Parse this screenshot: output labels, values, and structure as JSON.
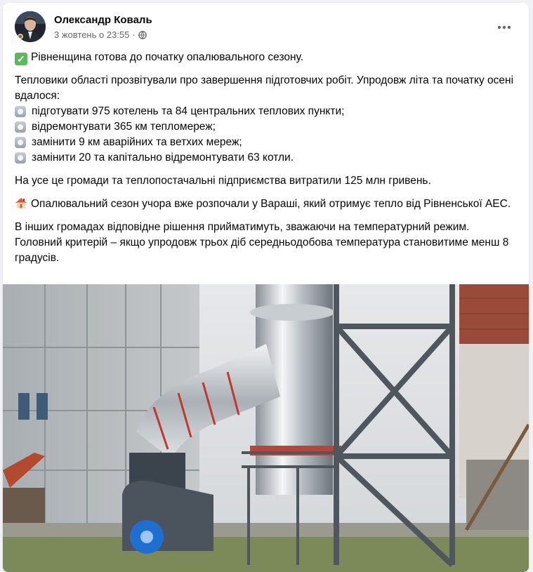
{
  "post": {
    "author": "Олександр Коваль",
    "timestamp": "3 жовтень о 23:55",
    "separator": "·",
    "more_label": "•••",
    "headline": "Рівненщина готова до початку опалювального сезону.",
    "intro": "Тепловики області прозвітували про завершення підготовчих робіт. Упродовж літа та початку осені вдалося:",
    "bullets": [
      "підготувати 975 котелень та 84 центральних теплових пункти;",
      "відремонтувати 365 км тепломереж;",
      "замінити 9 км аварійних та ветхих мереж;",
      "замінити 20 та капітально відремонтувати 63 котли."
    ],
    "spending": "На усе це громади та теплопостачальні підприємства витратили 125 млн гривень.",
    "varash": "Опалювальний сезон учора вже розпочали у Вараші, який отримує тепло від Рівненської АЕС.",
    "other": "В інших громадах відповідне рішення прийматимуть, зважаючи на температурний режим. Головний критерій – якщо упродовж трьох діб середньодобова температура становитиме менш 8 градусів.",
    "check_glyph": "✓"
  },
  "icons": {
    "headline": "check-mark-emoji",
    "bullet": "radio-button-emoji",
    "varash": "house-emoji",
    "privacy": "globe-icon",
    "menu": "more-options-icon"
  },
  "colors": {
    "background": "#f0f2f5",
    "card": "#ffffff",
    "text": "#050505",
    "meta": "#65676b",
    "check": "#5cb85c"
  }
}
